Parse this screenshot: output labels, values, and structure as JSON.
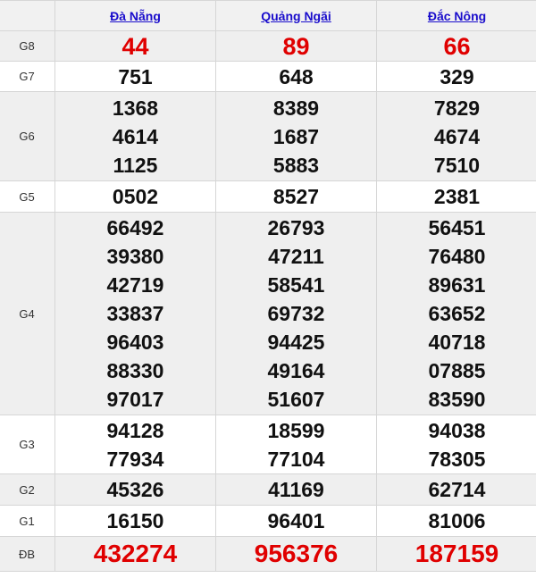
{
  "provinces": [
    "Đà Nẵng",
    "Quảng Ngãi",
    "Đắc Nông"
  ],
  "rows": [
    {
      "label": "G8",
      "values": [
        [
          "44"
        ],
        [
          "89"
        ],
        [
          "66"
        ]
      ]
    },
    {
      "label": "G7",
      "values": [
        [
          "751"
        ],
        [
          "648"
        ],
        [
          "329"
        ]
      ]
    },
    {
      "label": "G6",
      "values": [
        [
          "1368",
          "4614",
          "1125"
        ],
        [
          "8389",
          "1687",
          "5883"
        ],
        [
          "7829",
          "4674",
          "7510"
        ]
      ]
    },
    {
      "label": "G5",
      "values": [
        [
          "0502"
        ],
        [
          "8527"
        ],
        [
          "2381"
        ]
      ]
    },
    {
      "label": "G4",
      "values": [
        [
          "66492",
          "39380",
          "42719",
          "33837",
          "96403",
          "88330",
          "97017"
        ],
        [
          "26793",
          "47211",
          "58541",
          "69732",
          "94425",
          "49164",
          "51607"
        ],
        [
          "56451",
          "76480",
          "89631",
          "63652",
          "40718",
          "07885",
          "83590"
        ]
      ]
    },
    {
      "label": "G3",
      "values": [
        [
          "94128",
          "77934"
        ],
        [
          "18599",
          "77104"
        ],
        [
          "94038",
          "78305"
        ]
      ]
    },
    {
      "label": "G2",
      "values": [
        [
          "45326"
        ],
        [
          "41169"
        ],
        [
          "62714"
        ]
      ]
    },
    {
      "label": "G1",
      "values": [
        [
          "16150"
        ],
        [
          "96401"
        ],
        [
          "81006"
        ]
      ]
    },
    {
      "label": "ĐB",
      "values": [
        [
          "432274"
        ],
        [
          "956376"
        ],
        [
          "187159"
        ]
      ]
    }
  ],
  "colors": {
    "special_prize": "#e00000",
    "link": "#1a0dcc",
    "alt_row": "#efefef"
  }
}
